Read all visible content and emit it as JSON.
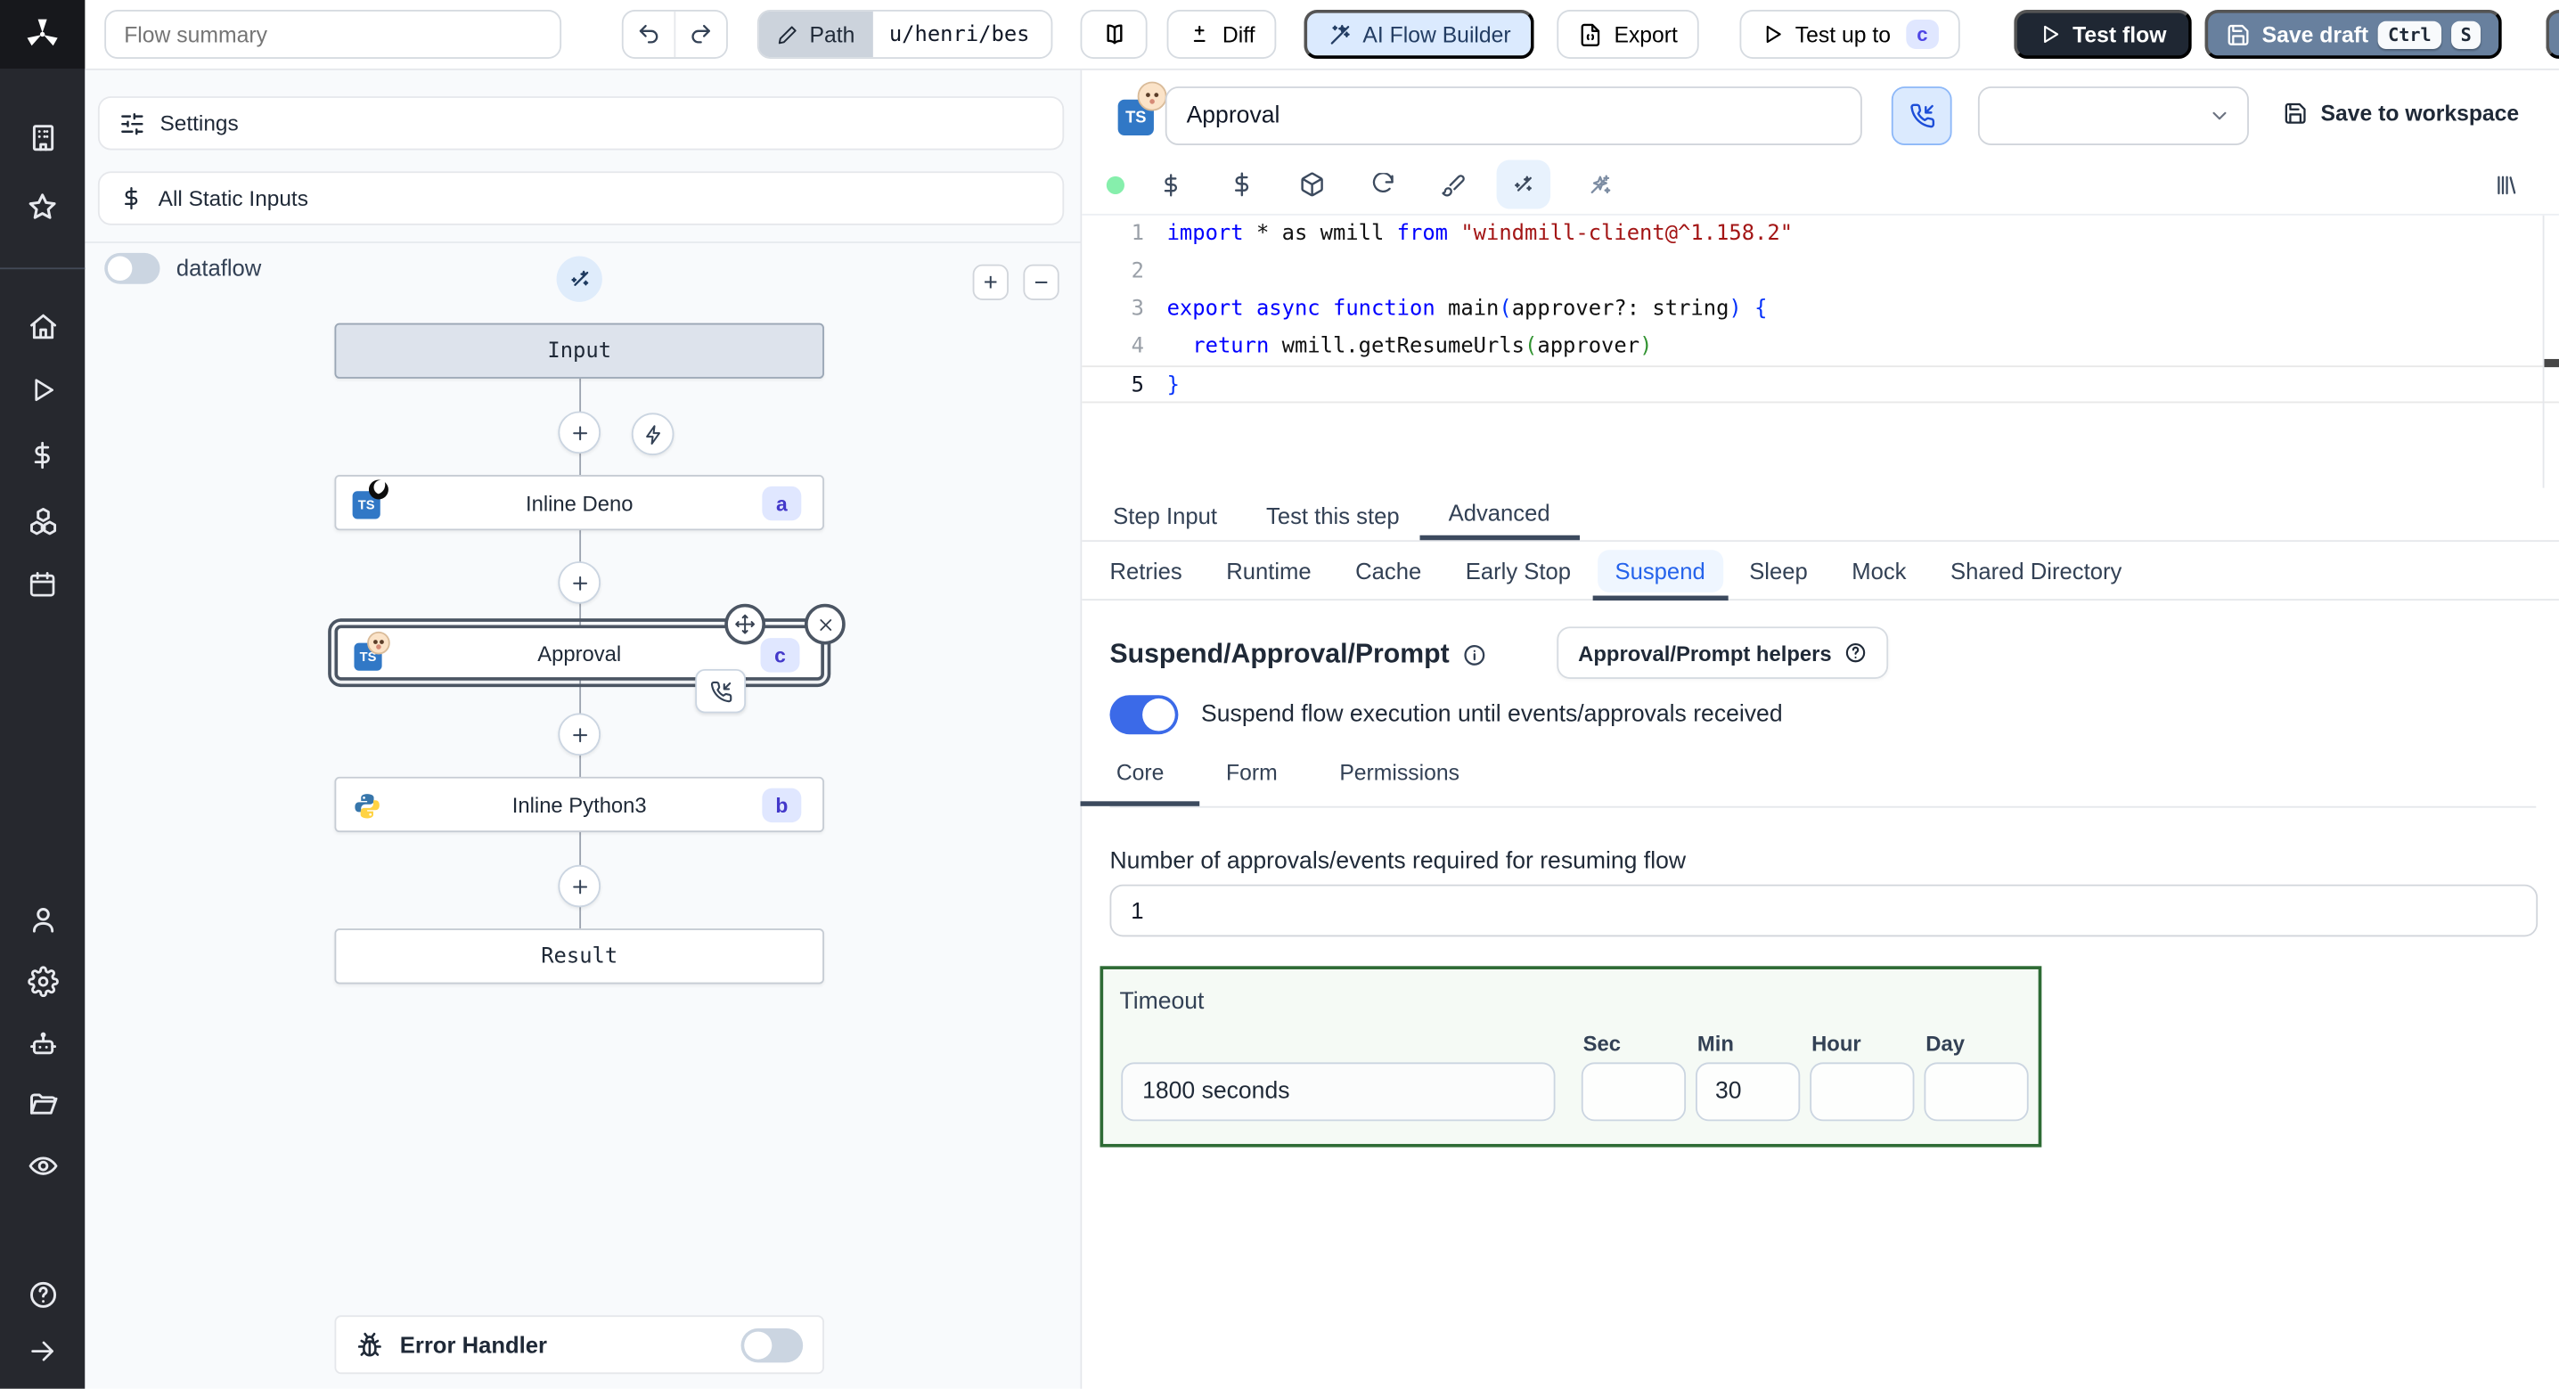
{
  "colors": {
    "accent_blue": "#2563eb",
    "toggle_on": "#3b6ae8",
    "badge_bg": "#e0e7ff",
    "badge_text": "#4338ca",
    "test_flow_bg": "#1f2733",
    "save_draft_bg": "#68809e",
    "ai_builder_bg": "#dbeafe",
    "timeout_border_green": "#2e6b35",
    "status_dot_green": "#86efac",
    "rail_bg": "#26282e"
  },
  "sidebar": {
    "icons": [
      "building",
      "star",
      "home",
      "play",
      "dollar",
      "cubes",
      "calendar",
      "user",
      "settings",
      "robot",
      "folder",
      "eye",
      "help",
      "arrow-right"
    ]
  },
  "topbar": {
    "flow_summary_placeholder": "Flow summary",
    "path": {
      "label": "Path",
      "value": "u/henri/bes"
    },
    "diff_label": "Diff",
    "ai_flow_builder_label": "AI Flow Builder",
    "export_label": "Export",
    "test_up_to": {
      "label": "Test up to",
      "badge": "c"
    },
    "test_flow_label": "Test flow",
    "save_draft": {
      "label": "Save draft",
      "key1": "Ctrl",
      "key2": "S"
    }
  },
  "flow": {
    "settings_label": "Settings",
    "all_static_inputs_label": "All Static Inputs",
    "dataflow_label": "dataflow",
    "zoom_in_label": "+",
    "zoom_out_label": "−",
    "nodes": {
      "input_label": "Input",
      "deno": {
        "label": "Inline Deno",
        "badge": "a"
      },
      "approval": {
        "label": "Approval",
        "badge": "c"
      },
      "python": {
        "label": "Inline Python3",
        "badge": "b"
      },
      "result_label": "Result"
    },
    "error_handler_label": "Error Handler"
  },
  "editor": {
    "step_name_value": "Approval",
    "save_to_workspace_label": "Save to workspace",
    "code": {
      "active_line": 5,
      "lines": [
        {
          "n": "1",
          "tokens": [
            [
              "kw",
              "import"
            ],
            [
              "pl",
              " * as wmill "
            ],
            [
              "kw",
              "from"
            ],
            [
              "pl",
              " "
            ],
            [
              "str",
              "\"windmill-client@^1.158.2\""
            ]
          ]
        },
        {
          "n": "2",
          "tokens": []
        },
        {
          "n": "3",
          "tokens": [
            [
              "kw",
              "export"
            ],
            [
              "pl",
              " "
            ],
            [
              "kw",
              "async"
            ],
            [
              "pl",
              " "
            ],
            [
              "kw",
              "function"
            ],
            [
              "pl",
              " main"
            ],
            [
              "b",
              "("
            ],
            [
              "pl",
              "approver?: string"
            ],
            [
              "b",
              ")"
            ],
            [
              "pl",
              " "
            ],
            [
              "b",
              "{"
            ]
          ]
        },
        {
          "n": "4",
          "tokens": [
            [
              "pl",
              "  "
            ],
            [
              "kw",
              "return"
            ],
            [
              "pl",
              " wmill.getResumeUrls"
            ],
            [
              "g",
              "("
            ],
            [
              "pl",
              "approver"
            ],
            [
              "g",
              ")"
            ]
          ]
        },
        {
          "n": "5",
          "tokens": [
            [
              "b",
              "}"
            ]
          ]
        }
      ]
    },
    "step_tabs": {
      "items": [
        "Step Input",
        "Test this step",
        "Advanced"
      ],
      "active": "Advanced"
    },
    "advanced_tabs": {
      "items": [
        "Retries",
        "Runtime",
        "Cache",
        "Early Stop",
        "Suspend",
        "Sleep",
        "Mock",
        "Shared Directory"
      ],
      "active": "Suspend"
    }
  },
  "suspend": {
    "heading": "Suspend/Approval/Prompt",
    "helpers_label": "Approval/Prompt helpers",
    "toggle_label": "Suspend flow execution until events/approvals received",
    "tabs": {
      "items": [
        "Core",
        "Form",
        "Permissions"
      ],
      "active": "Core"
    },
    "approvals_label": "Number of approvals/events required for resuming flow",
    "approvals_value": "1",
    "timeout": {
      "label": "Timeout",
      "display_value": "1800 seconds",
      "fields": [
        {
          "label": "Sec",
          "value": ""
        },
        {
          "label": "Min",
          "value": "30"
        },
        {
          "label": "Hour",
          "value": ""
        },
        {
          "label": "Day",
          "value": ""
        }
      ]
    }
  }
}
